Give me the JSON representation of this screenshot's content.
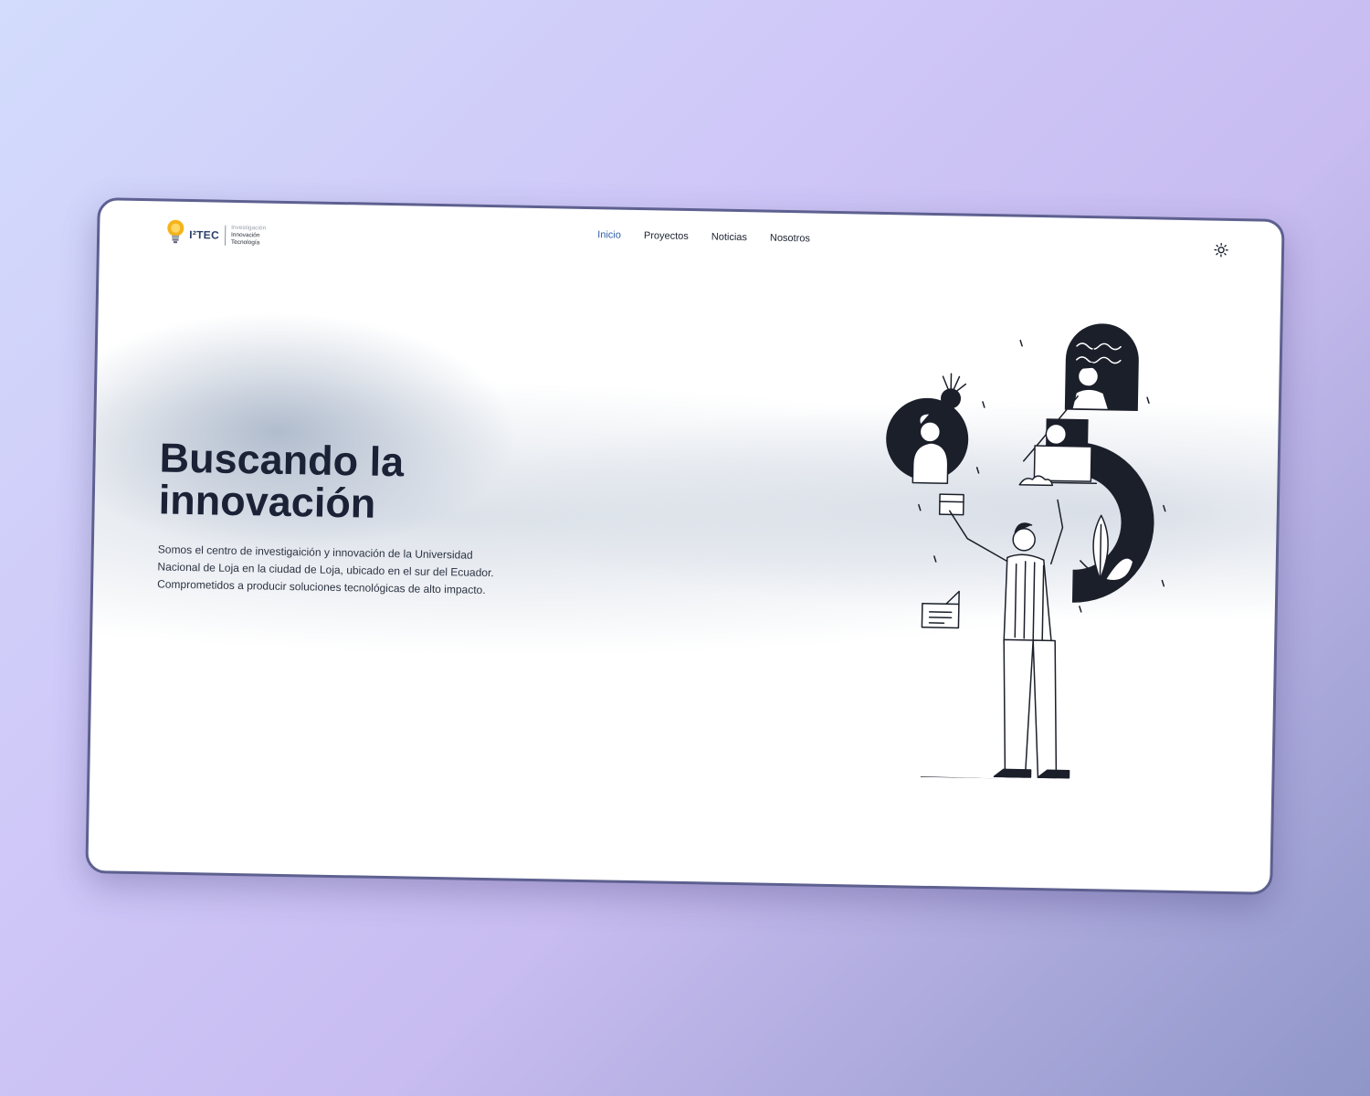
{
  "logo": {
    "wordmark": "I²TEC",
    "line1": "Investigación",
    "line2": "Innovación",
    "line3": "Tecnología"
  },
  "nav": {
    "items": [
      {
        "label": "Inicio",
        "active": true
      },
      {
        "label": "Proyectos",
        "active": false
      },
      {
        "label": "Noticias",
        "active": false
      },
      {
        "label": "Nosotros",
        "active": false
      }
    ]
  },
  "theme_toggle": {
    "icon": "sun-icon"
  },
  "hero": {
    "title_line1": "Buscando la",
    "title_line2": "innovación",
    "description_line1": "Somos el centro de investigaición y innovación de la Universidad",
    "description_line2": "Nacional de Loja en la ciudad de Loja, ubicado en el sur del Ecuador.",
    "description_line3": "Comprometidos a producir soluciones tecnológicas de alto impacto."
  },
  "colors": {
    "active_link": "#2f5fa8",
    "title": "#1b2236",
    "card_border": "#5e6090",
    "logo_bulb": "#f4b41a"
  }
}
